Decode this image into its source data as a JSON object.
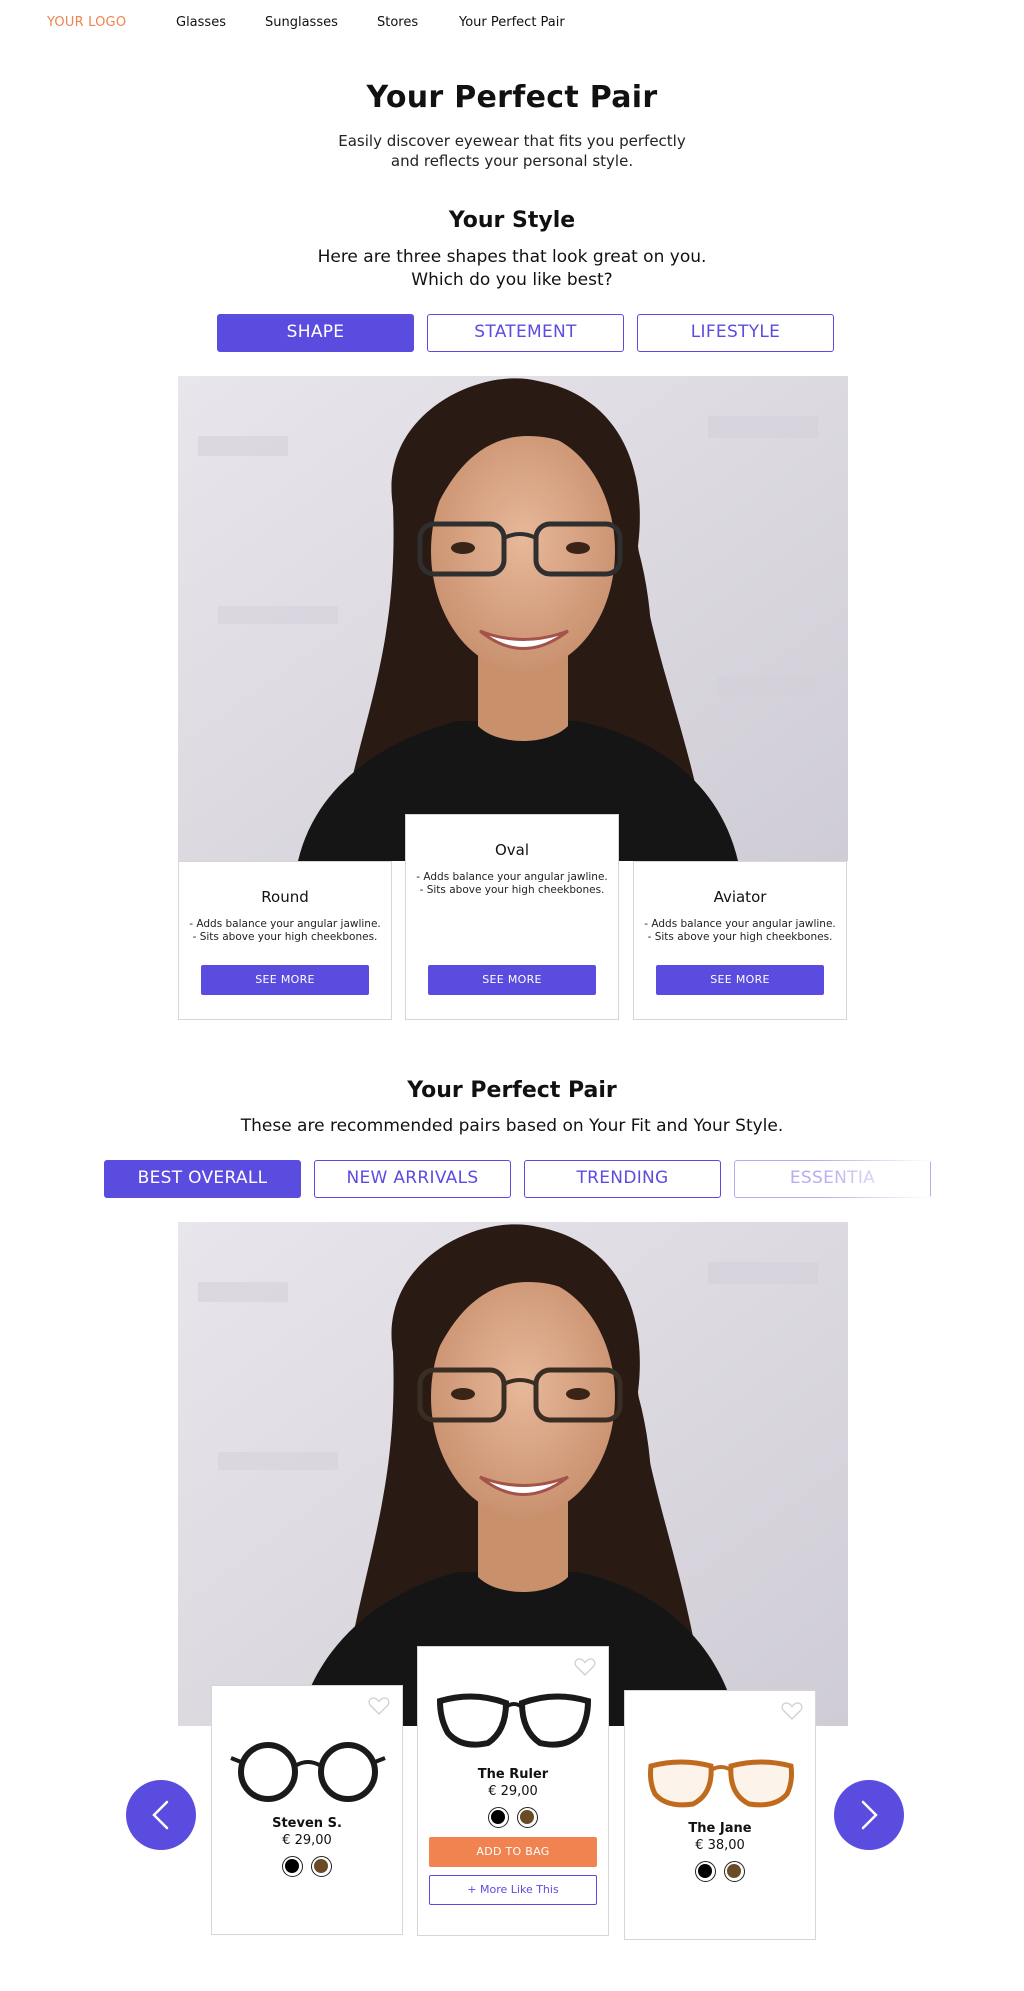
{
  "nav": {
    "logo": "YOUR LOGO",
    "links": [
      "Glasses",
      "Sunglasses",
      "Stores",
      "Your Perfect Pair"
    ]
  },
  "hero": {
    "title": "Your Perfect Pair",
    "subtitle_line1": "Easily discover eyewear that fits you perfectly",
    "subtitle_line2": "and reflects your personal style."
  },
  "style_section": {
    "title": "Your Style",
    "subtitle_line1": "Here are three shapes that look great on you.",
    "subtitle_line2": "Which do you like best?",
    "tabs": [
      "SHAPE",
      "STATEMENT",
      "LIFESTYLE"
    ],
    "active_tab": "SHAPE",
    "cards": [
      {
        "title": "Round",
        "line1": "- Adds balance your angular jawline.",
        "line2": "- Sits above your high cheekbones.",
        "button": "SEE MORE"
      },
      {
        "title": "Oval",
        "line1": "- Adds balance your angular jawline.",
        "line2": "- Sits above your high cheekbones.",
        "button": "SEE MORE"
      },
      {
        "title": "Aviator",
        "line1": "- Adds balance your angular jawline.",
        "line2": "- Sits above your high cheekbones.",
        "button": "SEE MORE"
      }
    ]
  },
  "pair_section": {
    "title": "Your Perfect Pair",
    "subtitle": "These are recommended pairs based on Your Fit and Your Style.",
    "tabs": [
      "BEST OVERALL",
      "NEW ARRIVALS",
      "TRENDING",
      "ESSENTIA"
    ],
    "active_tab": "BEST OVERALL",
    "products": [
      {
        "name": "Steven S.",
        "price": "€ 29,00",
        "swatches": [
          "black",
          "brown"
        ],
        "frame_color": "#1a1a1a"
      },
      {
        "name": "The Ruler",
        "price": "€ 29,00",
        "swatches": [
          "black",
          "brown"
        ],
        "frame_color": "#1a1a1a",
        "add_to_bag": "ADD TO BAG",
        "more_like": "+ More Like This"
      },
      {
        "name": "The Jane",
        "price": "€ 38,00",
        "swatches": [
          "black",
          "brown"
        ],
        "frame_color": "#c06a1e"
      }
    ]
  },
  "colors": {
    "accent": "#5b4ce0",
    "logo": "#f0834f",
    "add_to_bag": "#f0834f"
  },
  "icons": [
    "heart-icon",
    "chevron-left-icon",
    "chevron-right-icon"
  ]
}
